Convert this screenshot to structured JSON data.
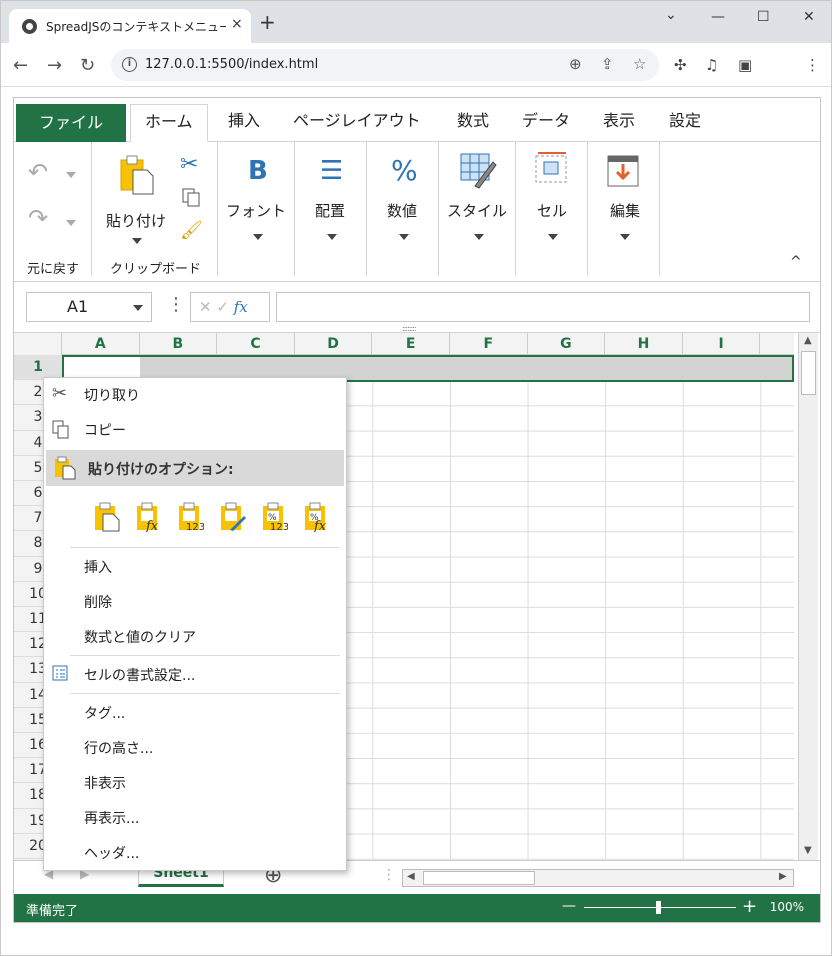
{
  "browser": {
    "tab_title": "SpreadJSのコンテキストメニューのカスタマイズ",
    "tab_close": "×",
    "new_tab": "+",
    "url": "127.0.0.1:5500/index.html",
    "win_min": "—",
    "win_max": "☐",
    "win_close": "✕"
  },
  "menubar": {
    "file": "ファイル",
    "tabs": [
      "ホーム",
      "挿入",
      "ページレイアウト",
      "数式",
      "データ",
      "表示",
      "設定"
    ]
  },
  "ribbon": {
    "undo_group": "元に戻す",
    "clipboard_group": "クリップボード",
    "paste": "貼り付け",
    "font": "フォント",
    "align": "配置",
    "number": "数値",
    "style": "スタイル",
    "cells": "セル",
    "edit": "編集",
    "collapse": "^"
  },
  "formula": {
    "namebox": "A1",
    "fx": "fx"
  },
  "grid": {
    "columns": [
      "A",
      "B",
      "C",
      "D",
      "E",
      "F",
      "G",
      "H",
      "I"
    ],
    "rows": [
      "1",
      "2",
      "3",
      "4",
      "5",
      "6",
      "7",
      "8",
      "9",
      "10",
      "11",
      "12",
      "13",
      "14",
      "15",
      "16",
      "17",
      "18",
      "19",
      "20"
    ]
  },
  "sheet_tab": "Sheet1",
  "status": {
    "ready": "準備完了",
    "zoom": "100%",
    "zoom_minus": "—",
    "zoom_plus": "+"
  },
  "context_menu": {
    "cut": "切り取り",
    "copy": "コピー",
    "paste_options": "貼り付けのオプション:",
    "insert": "挿入",
    "delete": "削除",
    "clear": "数式と値のクリア",
    "format_cells": "セルの書式設定...",
    "tag": "タグ...",
    "row_height": "行の高さ...",
    "hide": "非表示",
    "unhide": "再表示...",
    "header": "ヘッダ..."
  },
  "colors": {
    "accent": "#217346",
    "accent_blue": "#2e74b5",
    "icon_yellow": "#f8c200"
  }
}
